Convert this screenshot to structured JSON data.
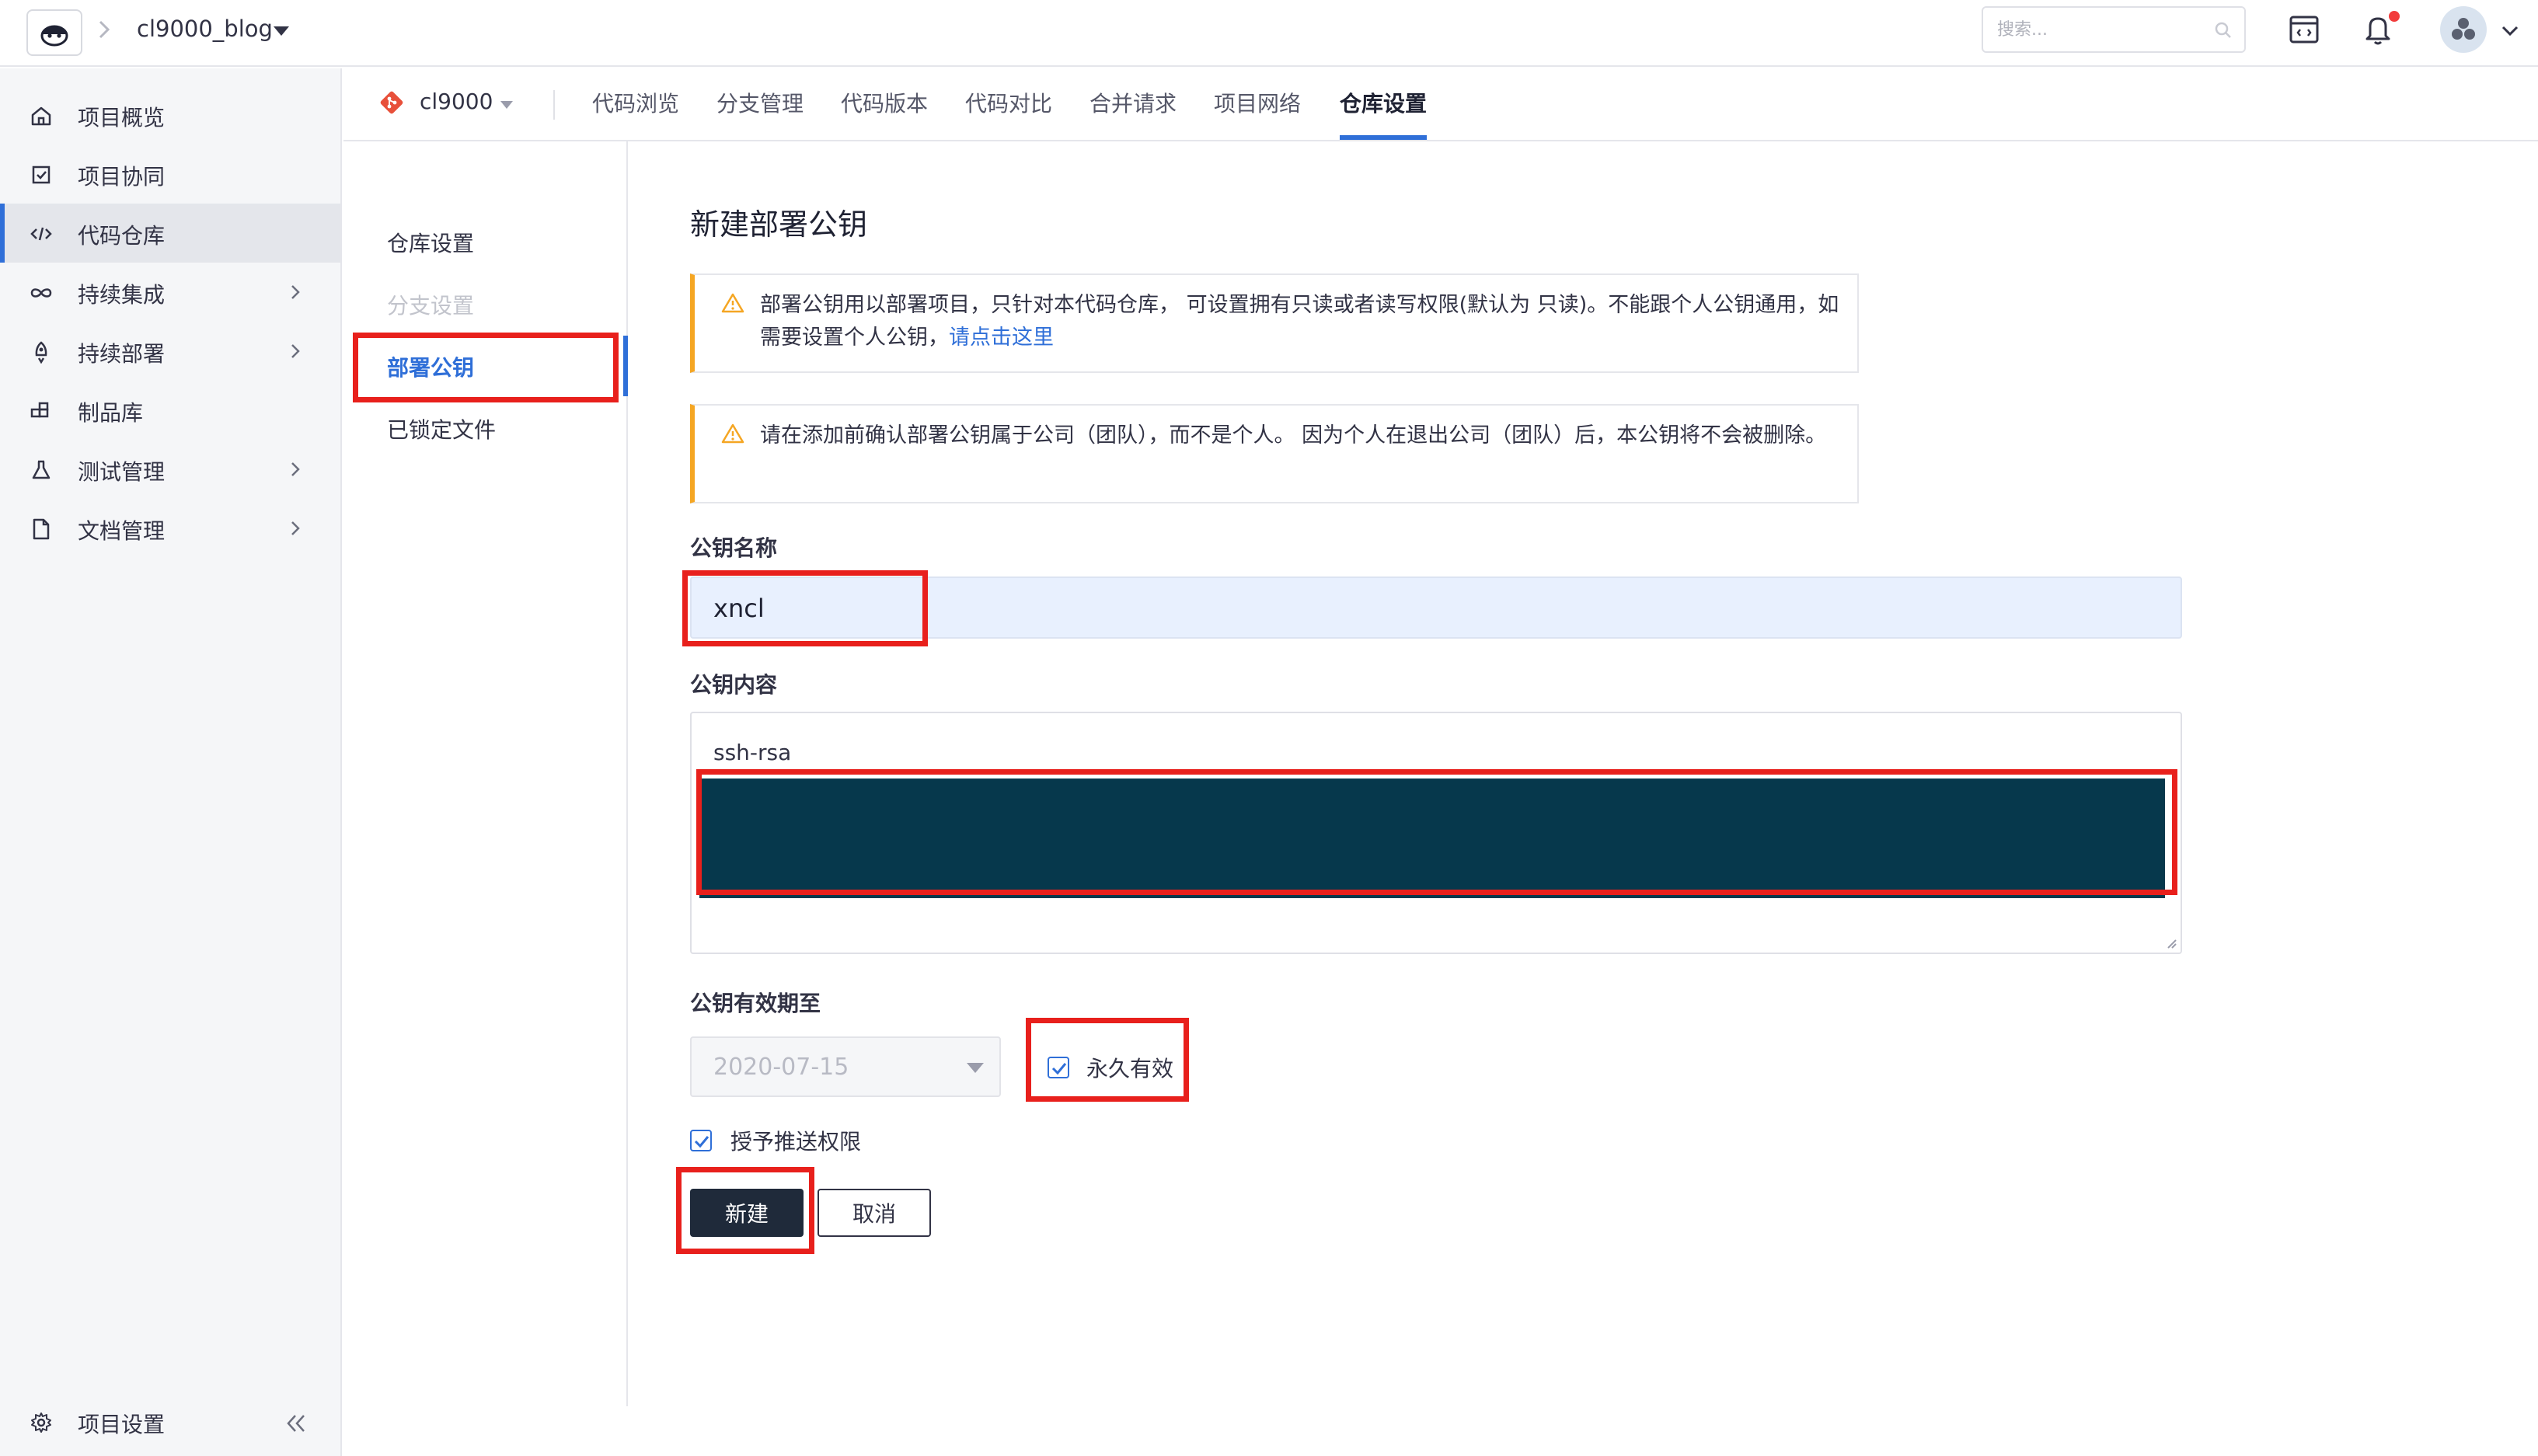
{
  "header": {
    "project_name": "cl9000_blog",
    "search_placeholder": "搜索...",
    "icons": [
      "window-icon",
      "bell-icon",
      "avatar"
    ]
  },
  "sidebar": {
    "items": [
      {
        "label": "项目概览",
        "icon": "home-icon",
        "has_children": false,
        "active": false
      },
      {
        "label": "项目协同",
        "icon": "checkbox-icon",
        "has_children": false,
        "active": false
      },
      {
        "label": "代码仓库",
        "icon": "code-icon",
        "has_children": false,
        "active": true
      },
      {
        "label": "持续集成",
        "icon": "infinity-icon",
        "has_children": true,
        "active": false
      },
      {
        "label": "持续部署",
        "icon": "rocket-icon",
        "has_children": true,
        "active": false
      },
      {
        "label": "制品库",
        "icon": "package-icon",
        "has_children": false,
        "active": false
      },
      {
        "label": "测试管理",
        "icon": "flask-icon",
        "has_children": true,
        "active": false
      },
      {
        "label": "文档管理",
        "icon": "document-icon",
        "has_children": true,
        "active": false
      }
    ],
    "settings_label": "项目设置"
  },
  "tabs": {
    "repo_name": "cl9000",
    "items": [
      "代码浏览",
      "分支管理",
      "代码版本",
      "代码对比",
      "合并请求",
      "项目网络",
      "仓库设置"
    ],
    "active": "仓库设置"
  },
  "submenu": {
    "items": [
      {
        "label": "仓库设置",
        "state": "normal"
      },
      {
        "label": "分支设置",
        "state": "disabled"
      },
      {
        "label": "部署公钥",
        "state": "active"
      },
      {
        "label": "已锁定文件",
        "state": "normal"
      }
    ]
  },
  "form": {
    "title": "新建部署公钥",
    "alert1_text": "部署公钥用以部署项目，只针对本代码仓库， 可设置拥有只读或者读写权限(默认为 只读)。不能跟个人公钥通用，如需要设置个人公钥，",
    "alert1_link": "请点击这里",
    "alert2_text": "请在添加前确认部署公钥属于公司（团队），而不是个人。 因为个人在退出公司（团队）后，本公钥将不会被删除。",
    "name_label": "公钥名称",
    "name_value": "xncl",
    "content_label": "公钥内容",
    "content_value": "ssh-rsa",
    "expiry_label": "公钥有效期至",
    "expiry_date": "2020-07-15",
    "permanent_label": "永久有效",
    "permanent_checked": true,
    "push_label": "授予推送权限",
    "push_checked": true,
    "create_button": "新建",
    "cancel_button": "取消"
  },
  "colors": {
    "accent": "#2f6fd8",
    "highlight": "#e8201c",
    "warning": "#f5a623",
    "primary_button": "#1f2a3a",
    "redacted": "#06384c"
  }
}
